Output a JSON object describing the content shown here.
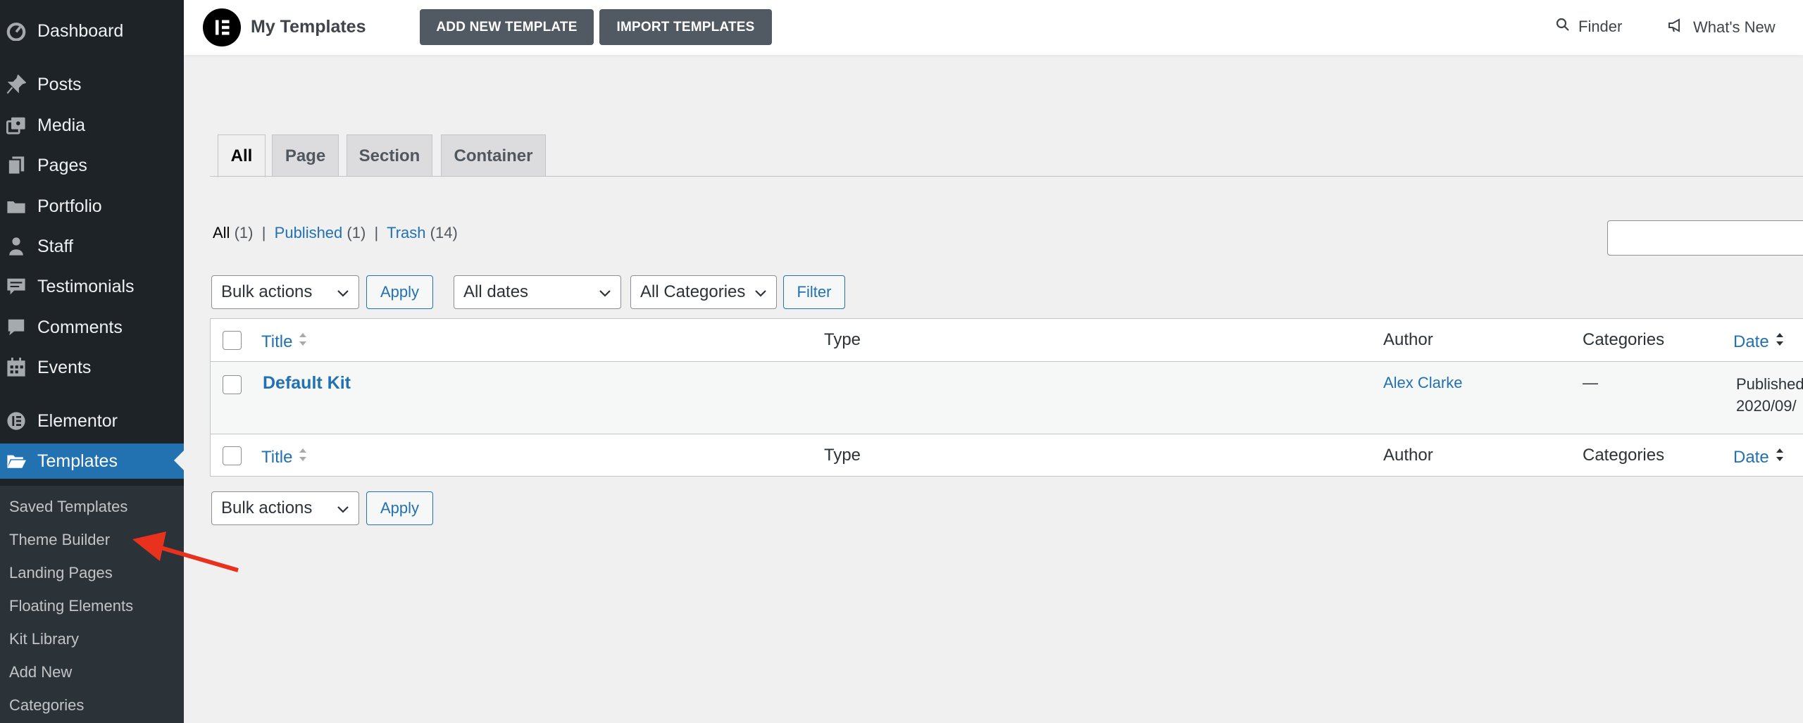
{
  "sidebar": {
    "items": [
      {
        "label": "Dashboard",
        "icon": "dashboard-icon"
      },
      {
        "label": "Posts",
        "icon": "pin-icon"
      },
      {
        "label": "Media",
        "icon": "media-icon"
      },
      {
        "label": "Pages",
        "icon": "pages-icon"
      },
      {
        "label": "Portfolio",
        "icon": "folder-icon"
      },
      {
        "label": "Staff",
        "icon": "person-icon"
      },
      {
        "label": "Testimonials",
        "icon": "testimonial-icon"
      },
      {
        "label": "Comments",
        "icon": "comment-icon"
      },
      {
        "label": "Events",
        "icon": "calendar-icon"
      },
      {
        "label": "Elementor",
        "icon": "elementor-icon"
      },
      {
        "label": "Templates",
        "icon": "folder-open-icon",
        "active": true
      }
    ],
    "submenu": [
      "Saved Templates",
      "Theme Builder",
      "Landing Pages",
      "Floating Elements",
      "Kit Library",
      "Add New",
      "Categories"
    ]
  },
  "header": {
    "title": "My Templates",
    "add_button": "ADD NEW TEMPLATE",
    "import_button": "IMPORT TEMPLATES",
    "finder": "Finder",
    "whats_new": "What's New"
  },
  "tabs": [
    "All",
    "Page",
    "Section",
    "Container"
  ],
  "status_links": {
    "all_label": "All",
    "all_count": "(1)",
    "published_label": "Published",
    "published_count": "(1)",
    "trash_label": "Trash",
    "trash_count": "(14)",
    "separator": "|"
  },
  "filters": {
    "bulk_actions": "Bulk actions",
    "apply": "Apply",
    "dates": "All dates",
    "categories": "All Categories",
    "filter": "Filter"
  },
  "table": {
    "columns": {
      "title": "Title",
      "type": "Type",
      "author": "Author",
      "categories": "Categories",
      "date": "Date"
    },
    "rows": [
      {
        "title": "Default Kit",
        "type": "",
        "author": "Alex Clarke",
        "categories": "—",
        "date_status": "Published",
        "date_value": "2020/09/"
      }
    ]
  },
  "colors": {
    "accent": "#2271b1",
    "sidebar": "#1d2327",
    "submenu": "#2c3338",
    "arrow": "#e8321e"
  }
}
